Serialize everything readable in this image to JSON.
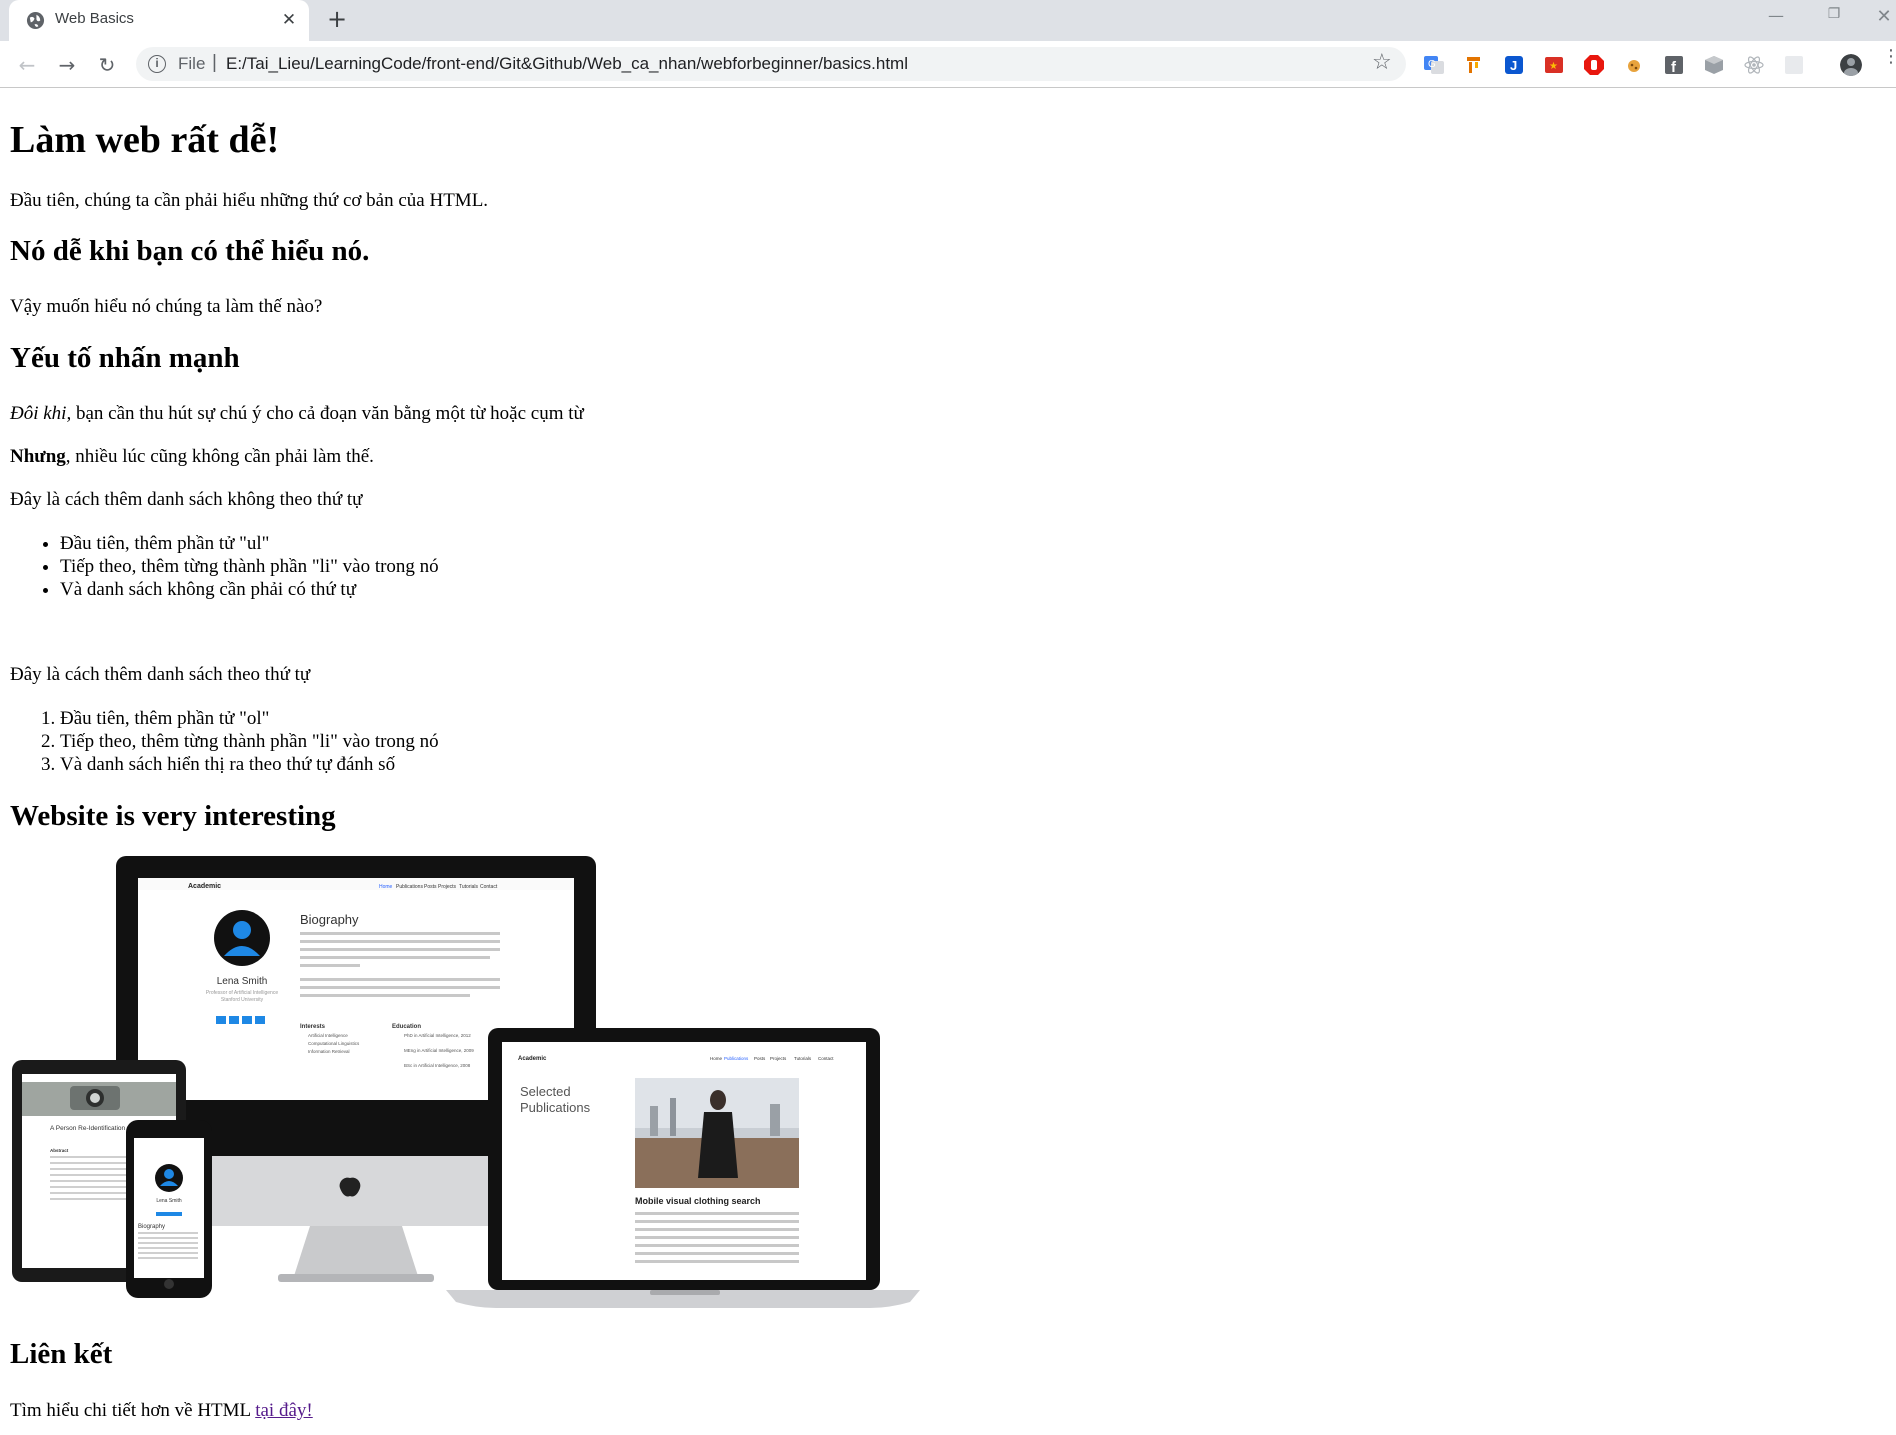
{
  "browser": {
    "tab_title": "Web Basics",
    "new_tab": "+",
    "scheme_label": "File",
    "url": "E:/Tai_Lieu/LearningCode/front-end/Git&Github/Web_ca_nhan/webforbeginner/basics.html",
    "extensions": [
      "google-translate-icon",
      "bookmark-extension-icon",
      "jira-extension-icon",
      "flag-extension-icon",
      "adblock-icon",
      "cookie-extension-icon",
      "facebook-extension-icon",
      "box-extension-icon",
      "react-devtools-icon",
      "blank-extension-icon"
    ]
  },
  "page": {
    "h1": "Làm web rất dễ!",
    "intro": "Đầu tiên, chúng ta cần phải hiểu những thứ cơ bản của HTML.",
    "h2_easy": "Nó dễ khi bạn có thể hiểu nó.",
    "question": "Vậy muốn hiểu nó chúng ta làm thế nào?",
    "h2_emphasis": "Yếu tố nhấn mạnh",
    "emphasis_italic": "Đôi khi,",
    "emphasis_rest": " bạn cần thu hút sự chú ý cho cả đoạn văn bằng một từ hoặc cụm từ",
    "strong_bold": "Nhưng",
    "strong_rest": ", nhiều lúc cũng không cần phải làm thế.",
    "ul_intro": "Đây là cách thêm danh sách không theo thứ tự",
    "ul_items": [
      "Đầu tiên, thêm phần tử \"ul\"",
      "Tiếp theo, thêm từng thành phần \"li\" vào trong nó",
      "Và danh sách không cần phải có thứ tự"
    ],
    "ol_intro": "Đây là cách thêm danh sách theo thứ tự",
    "ol_items": [
      "Đầu tiên, thêm phần tử \"ol\"",
      "Tiếp theo, thêm từng thành phần \"li\" vào trong nó",
      "Và danh sách hiển thị ra theo thứ tự đánh số"
    ],
    "h2_website": "Website is very interesting",
    "h2_links": "Liên kết",
    "link_text_prefix": "Tìm hiểu chi tiết hơn về HTML ",
    "link_label": "tại đây!"
  },
  "devices_image": {
    "site_name": "Academic",
    "nav": [
      "Home",
      "Publications",
      "Posts",
      "Projects",
      "Tutorials",
      "Contact"
    ],
    "biography_title": "Biography",
    "person_name": "Lena Smith",
    "person_role": "Professor of Artificial Intelligence",
    "person_org": "Stanford University",
    "interests_title": "Interests",
    "interests": [
      "Artificial Intelligence",
      "Computational Linguistics",
      "Information Retrieval"
    ],
    "education_title": "Education",
    "education": [
      "PhD in Artificial Intelligence, 2012",
      "MEng in Artificial Intelligence, 2009",
      "BSc in Artificial Intelligence, 2008"
    ],
    "laptop_heading_1": "Selected",
    "laptop_heading_2": "Publications",
    "pub_title": "Mobile visual clothing search",
    "tablet_title": "A Person Re-Identification System For Mobile Devices",
    "tablet_abstract": "Abstract",
    "phone_name": "Lena Smith",
    "phone_bio": "Biography"
  }
}
